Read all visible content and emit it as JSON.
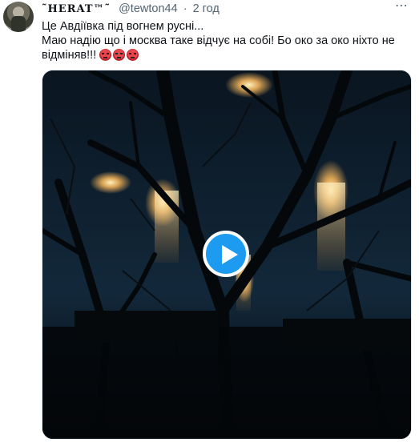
{
  "tweet": {
    "display_name": "˜HERAT™˜",
    "handle": "@tewton44",
    "separator": "·",
    "time": "2 год",
    "text_line1": "Це Авдіївка під вогнем русні...",
    "text_line2": "Маю надію що і москва таке відчує на собі! Бо око за око ніхто не відміняв!!!",
    "emojis": [
      "angry-face",
      "angry-face",
      "angry-face"
    ],
    "more_icon": "more-horizontal-icon",
    "more_glyph": "⋯"
  },
  "colors": {
    "text": "#0f1419",
    "muted": "#536471",
    "accent": "#1d9bf0",
    "video_sky": "#0b1a26"
  },
  "media": {
    "type": "video",
    "play_icon": "play-icon"
  }
}
